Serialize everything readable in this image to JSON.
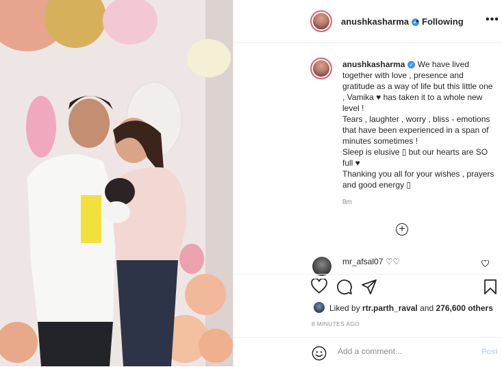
{
  "header": {
    "username": "anushkasharma",
    "separator": "•",
    "follow_status": "Following",
    "more": "•••"
  },
  "caption": {
    "username": "anushkasharma",
    "lines": [
      "We have lived together with love , presence and gratitude as a way of life but this little one , Vamika ♥ has taken it to a whole new level !",
      "Tears , laughter , worry , bliss - emotions that have been experienced in a span of minutes sometimes !",
      "Sleep is elusive ▯ but our hearts are SO full ♥",
      "Thanking you all for your wishes , prayers and good energy ▯"
    ],
    "time": "8m"
  },
  "comment": {
    "username": "mr_afsal07",
    "text": "♡♡"
  },
  "likes": {
    "prefix": "Liked by",
    "user": "rtr.parth_raval",
    "mid": "and",
    "count": "276,600 others"
  },
  "posted": "8 MINUTES AGO",
  "add_comment": {
    "placeholder": "Add a comment...",
    "post_label": "Post"
  },
  "icons": {
    "verified": "verified-badge-icon",
    "heart": "heart-icon",
    "comment": "comment-icon",
    "share": "share-icon",
    "save": "bookmark-icon",
    "emoji": "emoji-icon",
    "load_more": "plus-circle-icon"
  },
  "colors": {
    "verified": "#3897f0",
    "muted": "#8e8e8e",
    "post_disabled": "#b3dbff",
    "story_ring": "#e86175"
  }
}
